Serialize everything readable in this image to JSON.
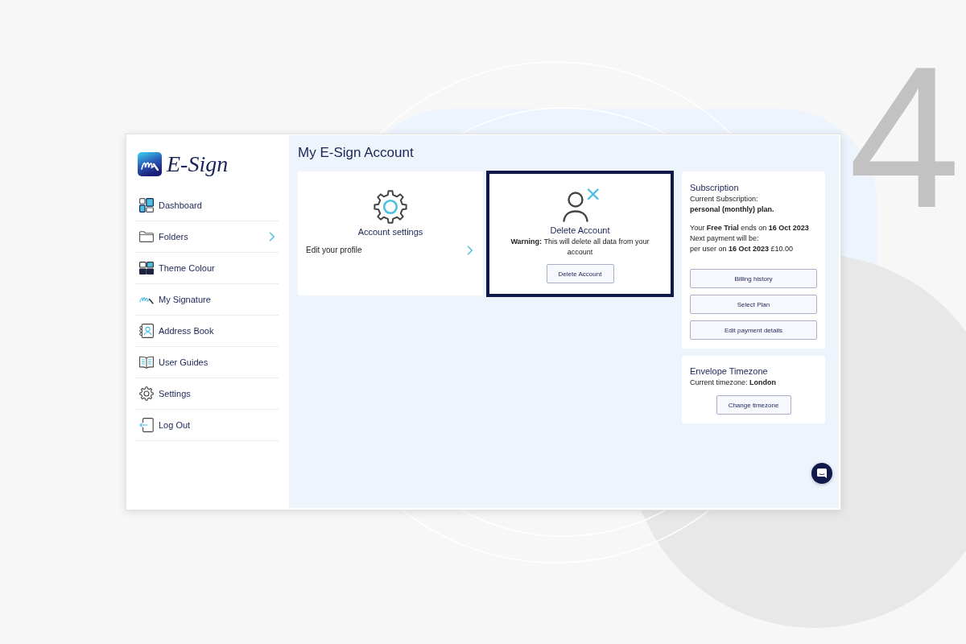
{
  "step_number": "4",
  "logo": {
    "text": "E-Sign"
  },
  "sidebar": {
    "items": [
      {
        "label": "Dashboard",
        "selected": false,
        "has_submenu": false
      },
      {
        "label": "Folders",
        "selected": false,
        "has_submenu": true
      },
      {
        "label": "Theme Colour",
        "selected": false,
        "has_submenu": false
      },
      {
        "label": "My Signature",
        "selected": false,
        "has_submenu": false
      },
      {
        "label": "Address Book",
        "selected": false,
        "has_submenu": false
      },
      {
        "label": "User Guides",
        "selected": false,
        "has_submenu": false
      },
      {
        "label": "Settings",
        "selected": false,
        "has_submenu": false
      },
      {
        "label": "Log Out",
        "selected": false,
        "has_submenu": false
      }
    ]
  },
  "page_title": "My E-Sign Account",
  "cards": [
    {
      "kind": "settings",
      "title": "Account settings",
      "link": "Edit your profile",
      "highlighted": false
    },
    {
      "kind": "delete",
      "title": "Delete Account",
      "warning": "**Warning:** This will delete all data from your account",
      "button": "Delete Account",
      "highlighted": true
    }
  ],
  "subscription": {
    "title": "Subscription",
    "current_label": "Current Subscription:",
    "plan": "personal (monthly) plan.",
    "details": [
      "Your **Free Trial** ends on **16 Oct 2023**",
      "Next payment will be:",
      "per user on **16 Oct 2023** £10.00"
    ],
    "buttons": [
      "Billing history",
      "Select Plan",
      "Edit payment details"
    ]
  },
  "timezone": {
    "title": "Envelope Timezone",
    "current": "Current timezone: **London**",
    "button": "Change timezone"
  }
}
